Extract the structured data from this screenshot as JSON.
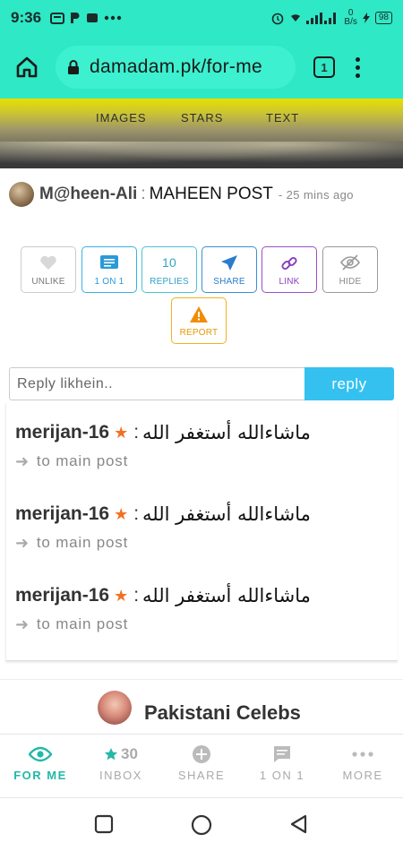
{
  "status_bar": {
    "time": "9:36",
    "data_speed_value": "0",
    "data_speed_unit": "B/s",
    "battery": "98"
  },
  "browser": {
    "url": "damadam.pk/for-me",
    "tab_count": "1"
  },
  "hero": {
    "nav": [
      "IMAGES",
      "STARS",
      "TEXT"
    ]
  },
  "post": {
    "user": "M@heen-Ali",
    "separator": ":",
    "title": "MAHEEN POST",
    "time": "- 25 mins ago"
  },
  "actions": {
    "unlike": "UNLIKE",
    "one_on_one": "1 ON 1",
    "replies_count": "10",
    "replies": "REPLIES",
    "share": "SHARE",
    "link": "LINK",
    "hide": "HIDE",
    "report": "REPORT"
  },
  "reply": {
    "placeholder": "Reply likhein..",
    "button": "reply"
  },
  "comments": [
    {
      "user": "merijan-16",
      "separator": ":",
      "text": "ماشاءالله أستغفر الله",
      "link": "to main post"
    },
    {
      "user": "merijan-16",
      "separator": ":",
      "text": "ماشاءالله أستغفر الله",
      "link": "to main post"
    },
    {
      "user": "merijan-16",
      "separator": ":",
      "text": "ماشاءالله أستغفر الله",
      "link": "to main post"
    }
  ],
  "celebs": {
    "title": "Pakistani Celebs"
  },
  "bottom_nav": {
    "items": [
      {
        "label": "FOR ME",
        "icon": "eye-icon",
        "active": true
      },
      {
        "label": "INBOX",
        "icon": "star-icon",
        "count": "30"
      },
      {
        "label": "SHARE",
        "icon": "plus-circle-icon"
      },
      {
        "label": "1 ON 1",
        "icon": "chat-icon"
      },
      {
        "label": "MORE",
        "icon": "dots-icon"
      }
    ]
  },
  "colors": {
    "accent": "#2ee8c6",
    "active_nav": "#23b8a8",
    "reply_button": "#34c1f0",
    "star": "#f27024",
    "report": "#f2b21c",
    "link": "#9b4fc8"
  }
}
